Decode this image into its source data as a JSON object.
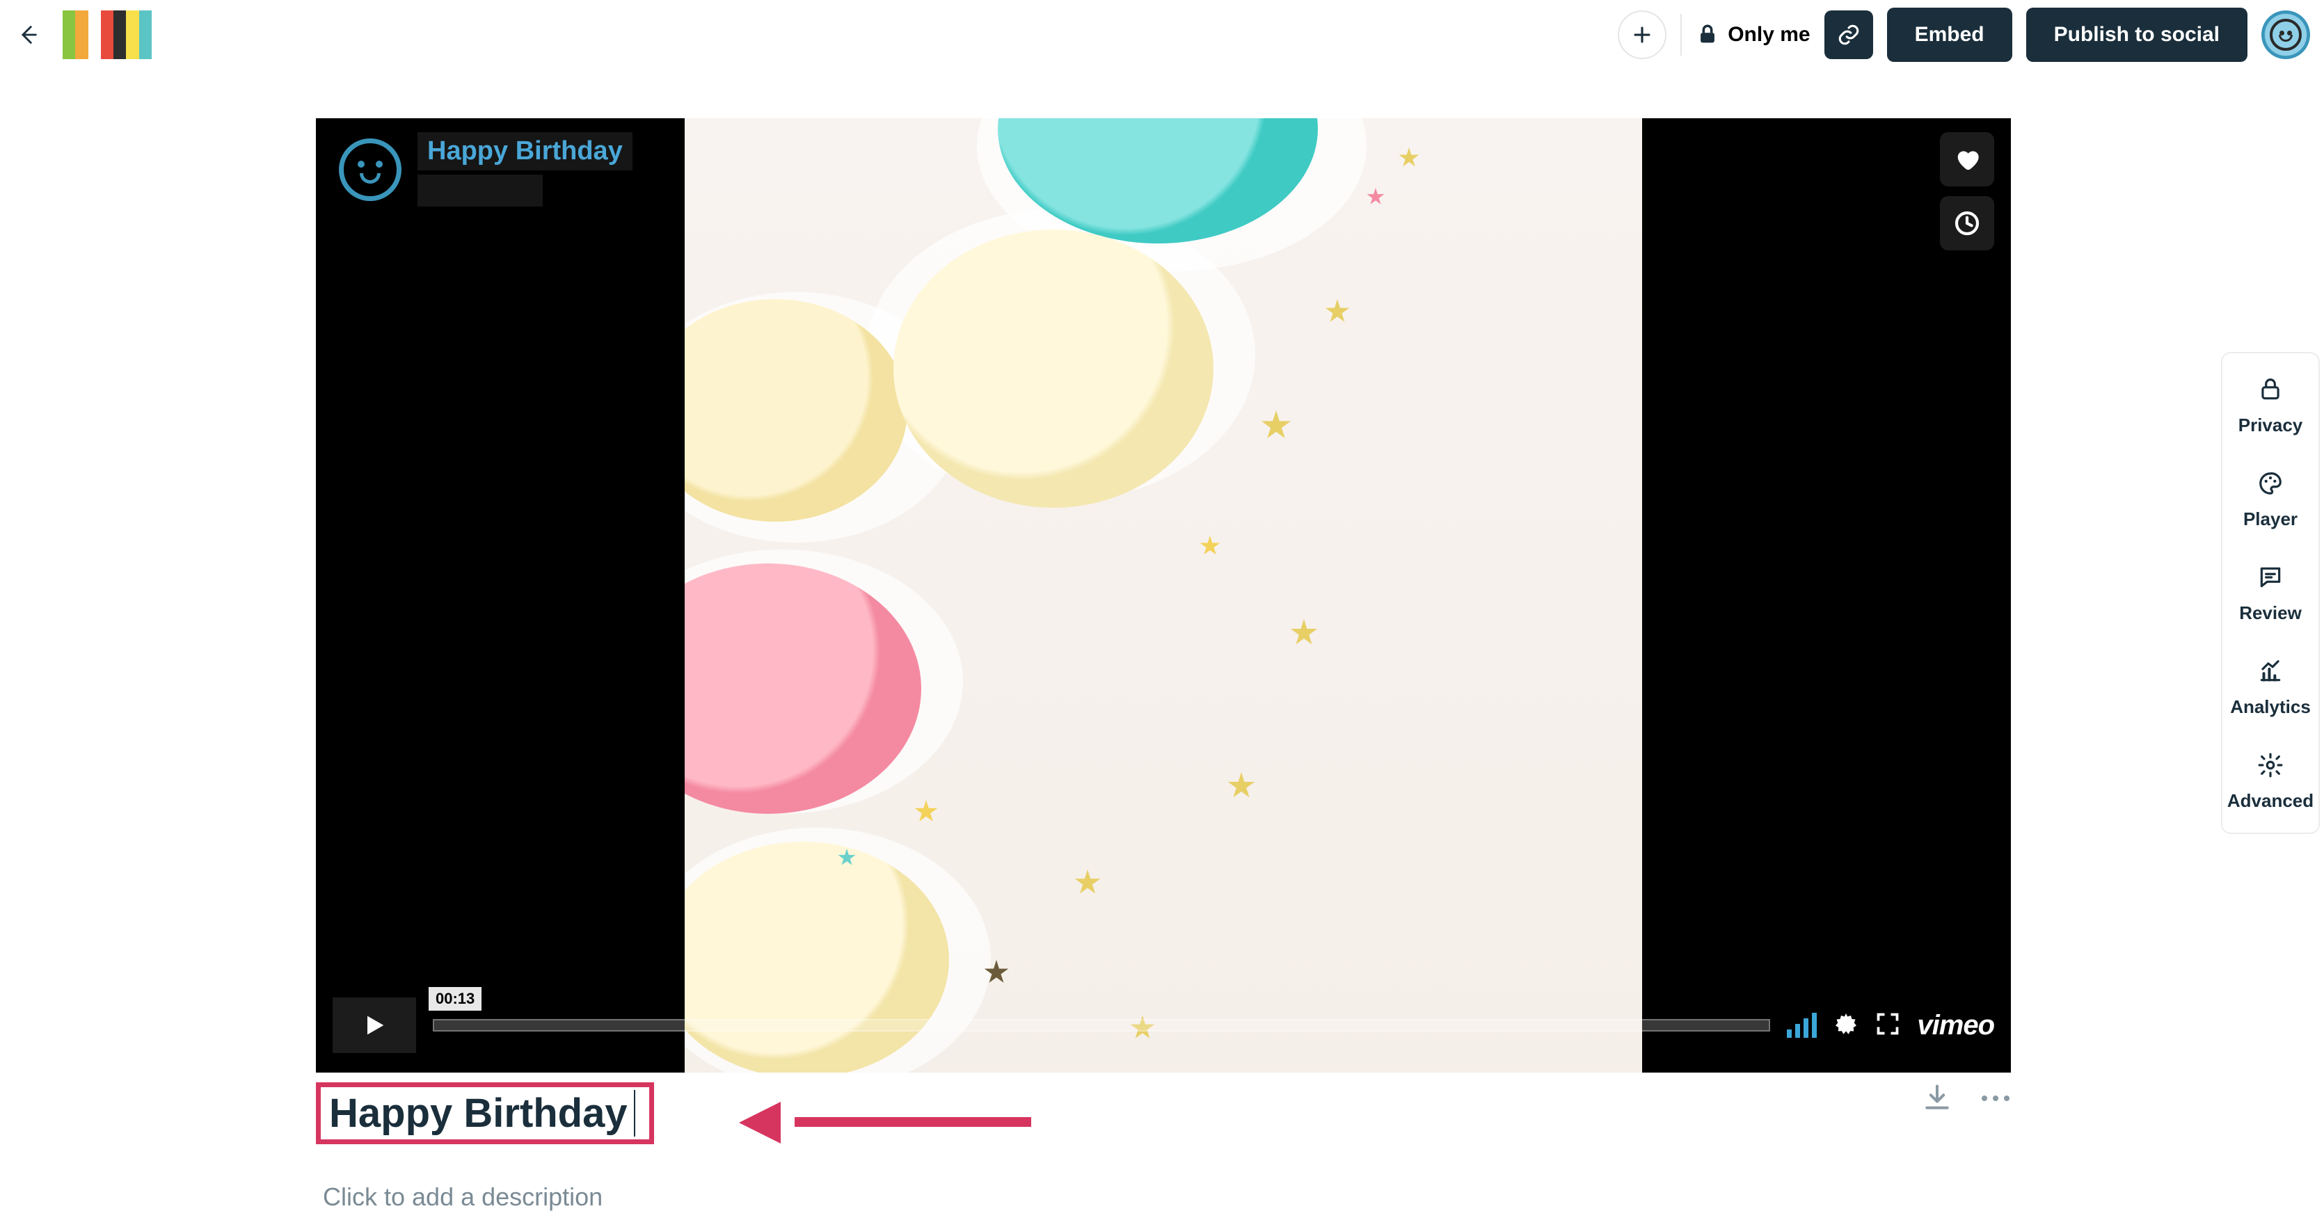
{
  "header": {
    "privacy_label": "Only me",
    "embed_label": "Embed",
    "publish_label": "Publish to social"
  },
  "player": {
    "overlay_title": "Happy Birthday",
    "time_label": "00:13",
    "logo_word": "vimeo"
  },
  "edit": {
    "title_value": "Happy Birthday",
    "description_placeholder": "Click to add a description"
  },
  "sidebar": {
    "items": [
      {
        "label": "Privacy"
      },
      {
        "label": "Player"
      },
      {
        "label": "Review"
      },
      {
        "label": "Analytics"
      },
      {
        "label": "Advanced"
      }
    ]
  }
}
